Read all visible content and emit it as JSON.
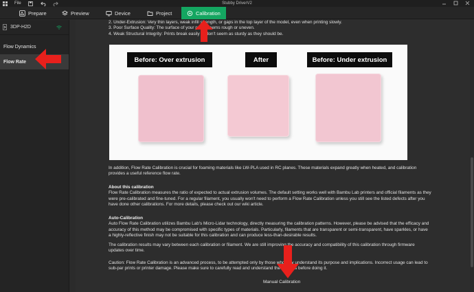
{
  "window": {
    "title": "Stubby DriverV2",
    "menu_file": "File"
  },
  "tabs": [
    {
      "label": "Prepare",
      "icon": "prepare-icon"
    },
    {
      "label": "Preview",
      "icon": "preview-icon"
    },
    {
      "label": "Device",
      "icon": "device-icon"
    },
    {
      "label": "Project",
      "icon": "project-icon"
    },
    {
      "label": "Calibration",
      "icon": "calibration-icon",
      "active": true
    }
  ],
  "sidebar": {
    "printer": "3DP-H2D",
    "items": [
      {
        "label": "Flow Dynamics",
        "active": false
      },
      {
        "label": "Flow Rate",
        "active": true
      }
    ]
  },
  "content": {
    "issues": [
      "2. Under-Extrusion: Very thin layers, weak infill strength, or gaps in the top layer of the model, even when printing slowly.",
      "3. Poor Surface Quality: The surface of your prints seems rough or uneven.",
      "4. Weak Structural Integrity: Prints break easily or don't seem as sturdy as they should be."
    ],
    "photo_labels": {
      "over": "Before: Over extrusion",
      "after": "After",
      "under": "Before: Under extrusion"
    },
    "intro": "In addition, Flow Rate Calibration is crucial for foaming materials like LW-PLA used in RC planes. These materials expand greatly when heated, and calibration provides a useful reference flow rate.",
    "about_heading": "About this calibration",
    "about_text": "Flow Rate Calibration measures the ratio of expected to actual extrusion volumes. The default setting works well with Bambu Lab printers and official filaments as they were pre-calibrated and fine-tuned. For a regular filament, you usually won't need to perform a Flow Rate Calibration unless you still see the listed defects after you have done other calibrations. For more details, please check out our wiki article.",
    "auto_heading": "Auto-Calibration",
    "auto_text": "Auto Flow Rate Calibration utilizes Bambu Lab's Micro-Lidar technology, directly measuring the calibration patterns. However, please be advised that the efficacy and accuracy of this method may be compromised with specific types of materials. Particularly, filaments that are transparent or semi-transparent, have sparkles, or have a highly-reflective finish may not be suitable for this calibration and can produce less-than-desirable results.",
    "results_text": "The calibration results may vary between each calibration or filament. We are still improving the accuracy and compatibility of this calibration through firmware updates over time.",
    "caution_text": "Caution: Flow Rate Calibration is an advanced process, to be attempted only by those who fully understand its purpose and implications. Incorrect usage can lead to sub-par prints or printer damage. Please make sure to carefully read and understand the process before doing it.",
    "manual_button": "Manual Calibration"
  },
  "colors": {
    "accent": "#14a661",
    "arrow": "#e8201c",
    "sample_pink": "#f2c4cf"
  }
}
